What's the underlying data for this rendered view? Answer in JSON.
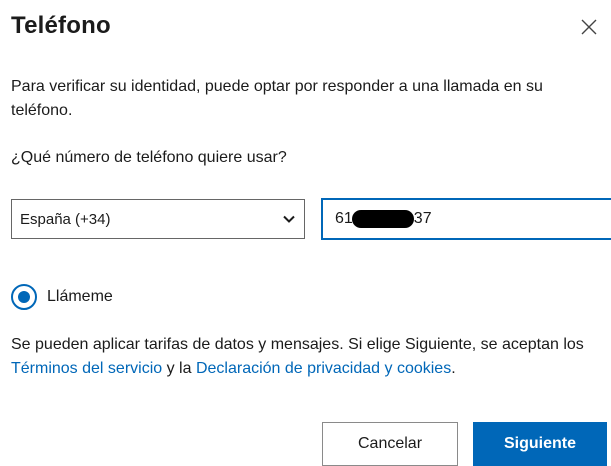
{
  "dialog": {
    "title": "Teléfono",
    "close_icon": "close-icon",
    "description": "Para verificar su identidad, puede optar por responder a una llamada en su teléfono.",
    "question": "¿Qué número de teléfono quiere usar?"
  },
  "country_select": {
    "selected": "España (+34)",
    "icon": "chevron-down-icon"
  },
  "phone_input": {
    "prefix": "61",
    "suffix": "37",
    "redacted": true
  },
  "option": {
    "label": "Llámeme",
    "selected": true
  },
  "terms": {
    "text_1": "Se pueden aplicar tarifas de datos y mensajes. Si elige Siguiente, se aceptan los ",
    "link_terms": "Términos del servicio",
    "text_2": " y la ",
    "link_privacy": "Declaración de privacidad y cookies",
    "text_3": "."
  },
  "buttons": {
    "cancel": "Cancelar",
    "next": "Siguiente"
  },
  "colors": {
    "accent": "#0067b8",
    "text": "#1b1b1b"
  }
}
